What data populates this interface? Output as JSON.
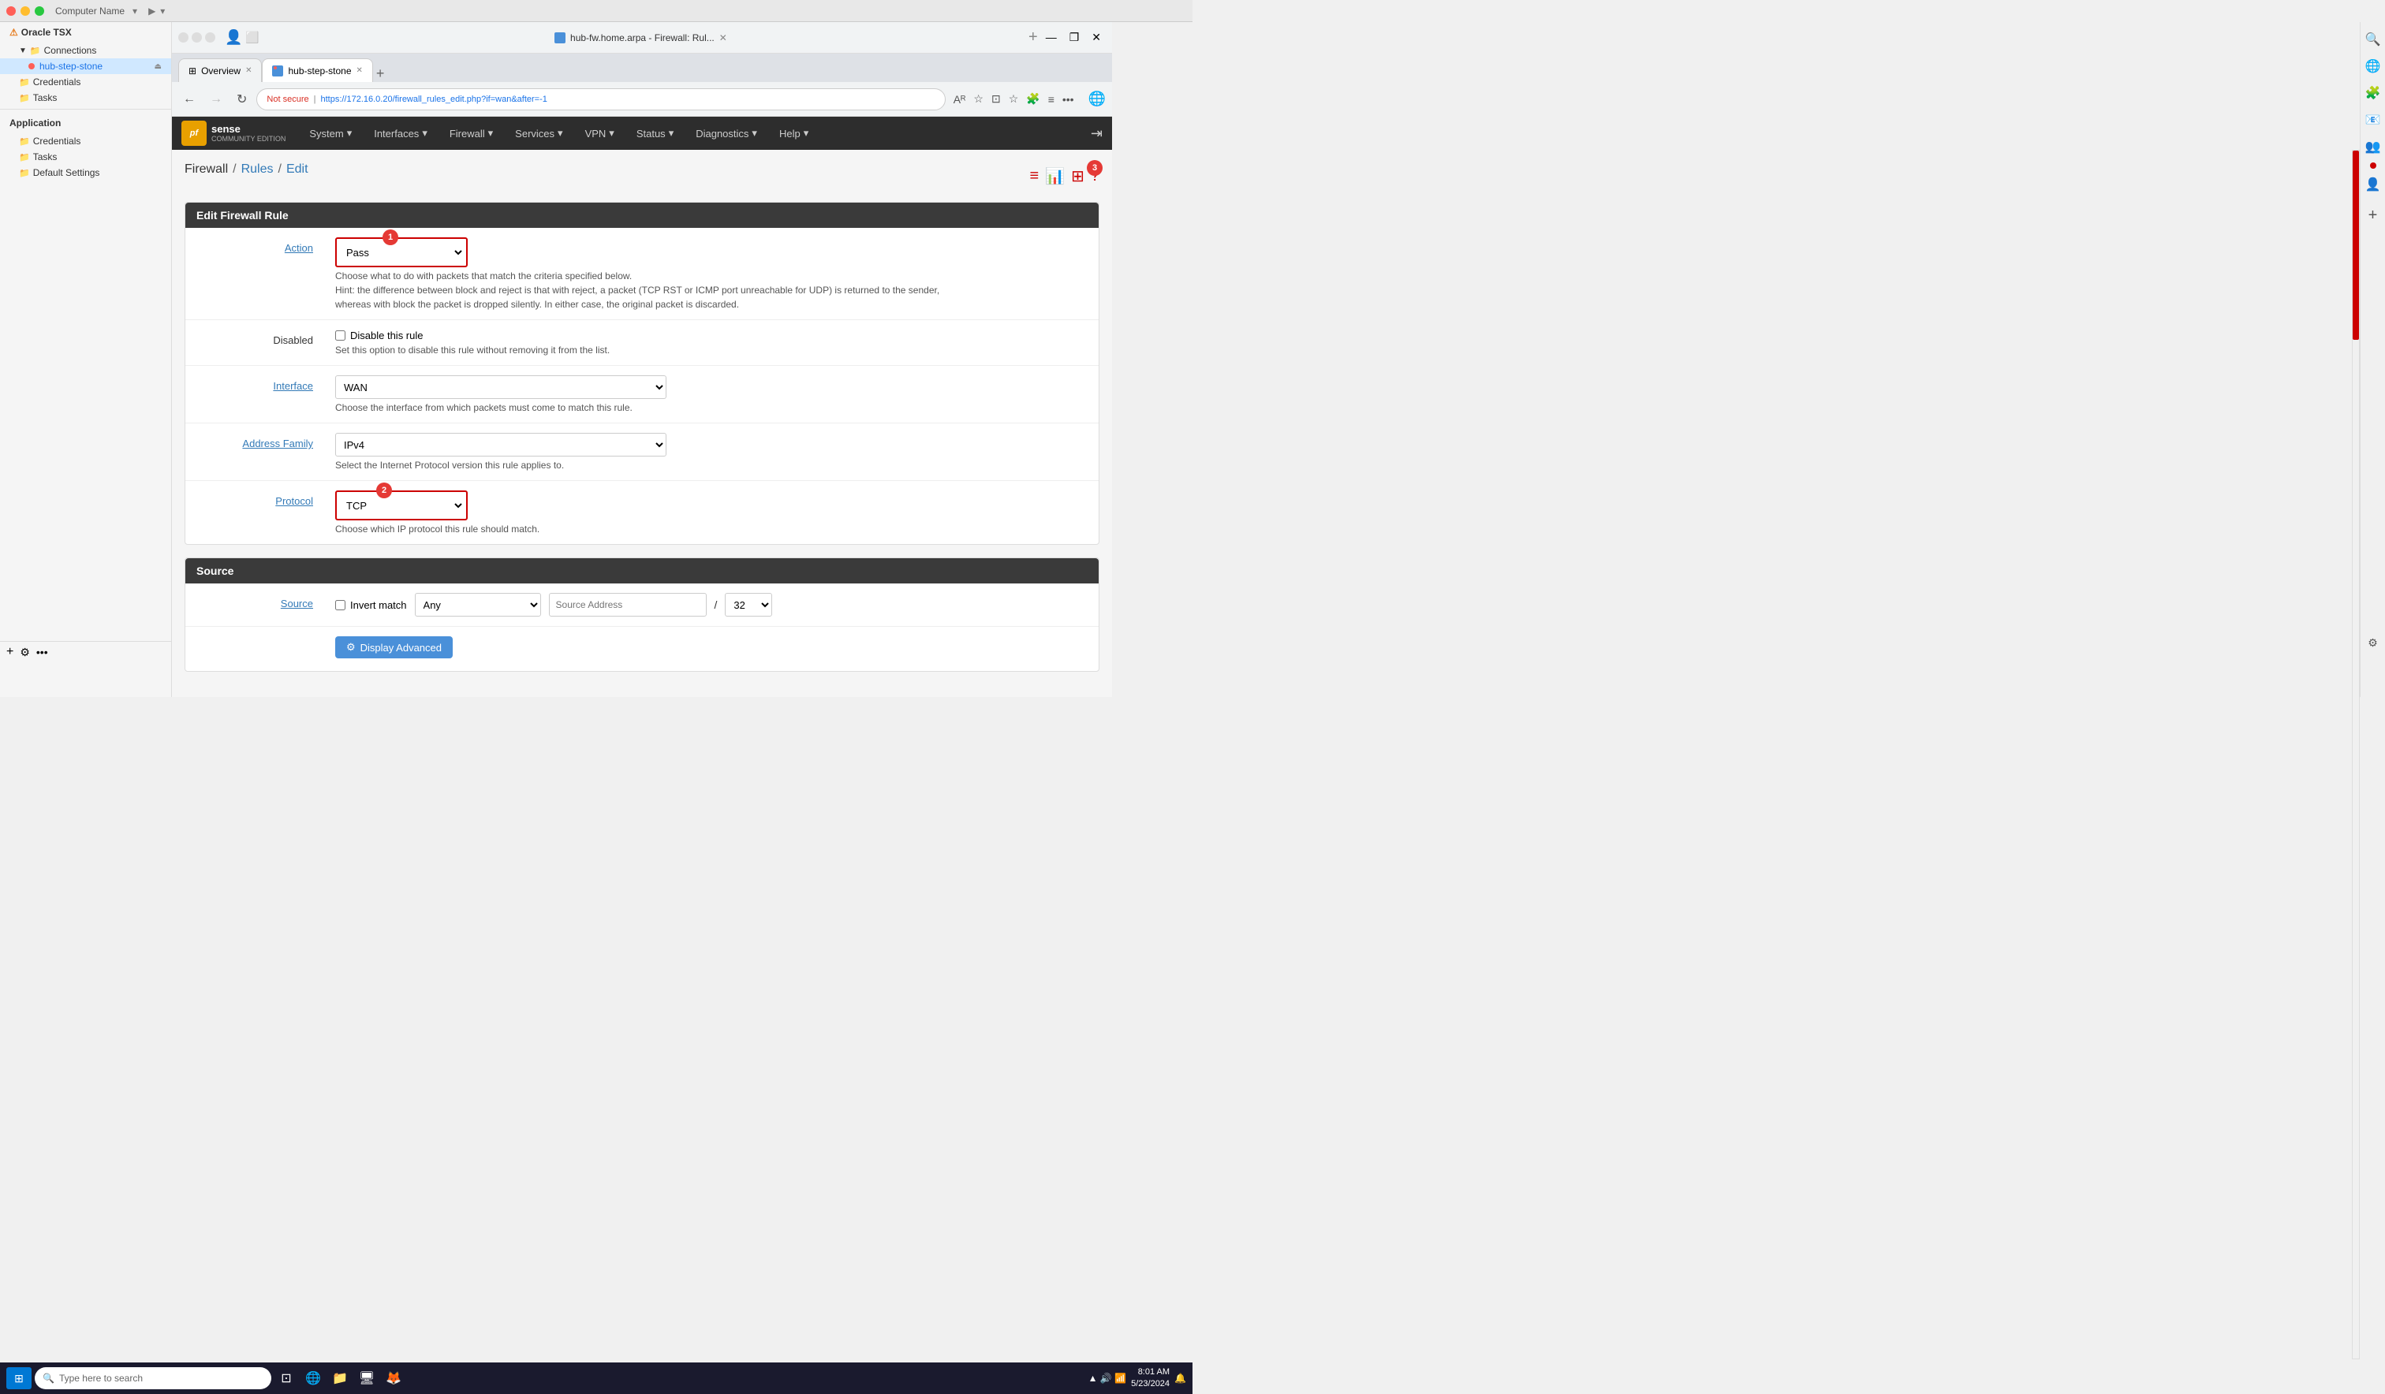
{
  "window": {
    "title": "hub-fw.home.arpa - Firewall: Rul..."
  },
  "mac_titlebar": {
    "computer_name": "Computer Name"
  },
  "tabs": [
    {
      "id": "overview",
      "label": "Overview",
      "active": false,
      "favicon": "grid"
    },
    {
      "id": "hub-step-stone",
      "label": "hub-step-stone",
      "active": true,
      "favicon": "pfsense"
    }
  ],
  "browser": {
    "url": "https://172.16.0.20/firewall_rules_edit.php?if=wan&after=-1",
    "url_display": "https://172.16.0.20/firewall_rules_edit.php?if=wan&after=-1",
    "not_secure_label": "Not secure",
    "add_tab": "+"
  },
  "pfsense": {
    "logo_text1": "pf",
    "logo_text2": "sense",
    "logo_sub": "COMMUNITY EDITION",
    "nav": {
      "items": [
        {
          "label": "System",
          "has_arrow": true
        },
        {
          "label": "Interfaces",
          "has_arrow": true
        },
        {
          "label": "Firewall",
          "has_arrow": true
        },
        {
          "label": "Services",
          "has_arrow": true
        },
        {
          "label": "VPN",
          "has_arrow": true
        },
        {
          "label": "Status",
          "has_arrow": true
        },
        {
          "label": "Diagnostics",
          "has_arrow": true
        },
        {
          "label": "Help",
          "has_arrow": true
        }
      ]
    },
    "breadcrumb": {
      "parts": [
        "Firewall",
        "Rules",
        "Edit"
      ],
      "separators": [
        "/",
        "/"
      ]
    },
    "page_title": "Edit Firewall Rule",
    "badge1": "1",
    "badge2": "2",
    "badge3": "3",
    "form": {
      "action_label": "Action",
      "action_value": "Pass",
      "action_hint": "Choose what to do with packets that match the criteria specified below.",
      "action_hint2": "Hint: the difference between block and reject is that with reject, a packet (TCP RST or ICMP port unreachable for UDP) is returned to the sender,",
      "action_hint3": "whereas with block the packet is dropped silently. In either case, the original packet is discarded.",
      "disabled_label": "Disabled",
      "disabled_checkbox_label": "Disable this rule",
      "disabled_hint": "Set this option to disable this rule without removing it from the list.",
      "interface_label": "Interface",
      "interface_value": "WAN",
      "interface_hint": "Choose the interface from which packets must come to match this rule.",
      "address_family_label": "Address Family",
      "address_family_value": "IPv4",
      "address_family_hint": "Select the Internet Protocol version this rule applies to.",
      "protocol_label": "Protocol",
      "protocol_value": "TCP",
      "protocol_hint": "Choose which IP protocol this rule should match.",
      "source_section": "Source",
      "source_label": "Source",
      "invert_match_label": "Invert match",
      "source_any_value": "Any",
      "source_address_placeholder": "Source Address",
      "display_advanced_label": "Display Advanced"
    }
  },
  "sidebar": {
    "sections": [
      {
        "label": "Oracle TSX"
      },
      {
        "label": "Connections",
        "expanded": true
      },
      {
        "label": "hub-step-stone",
        "active": true
      },
      {
        "label": "Credentials"
      },
      {
        "label": "Tasks"
      }
    ],
    "application_label": "Application",
    "app_items": [
      {
        "label": "Credentials"
      },
      {
        "label": "Tasks"
      },
      {
        "label": "Default Settings"
      }
    ]
  },
  "taskbar": {
    "search_placeholder": "Type here to search",
    "time": "8:01 AM",
    "date": "5/23/2024"
  },
  "icons": {
    "search": "🔍",
    "gear": "⚙",
    "grid": "⊞",
    "back": "←",
    "forward": "→",
    "refresh": "↻",
    "star": "☆",
    "shield": "🔒",
    "settings": "⚙",
    "cog": "⚙"
  }
}
